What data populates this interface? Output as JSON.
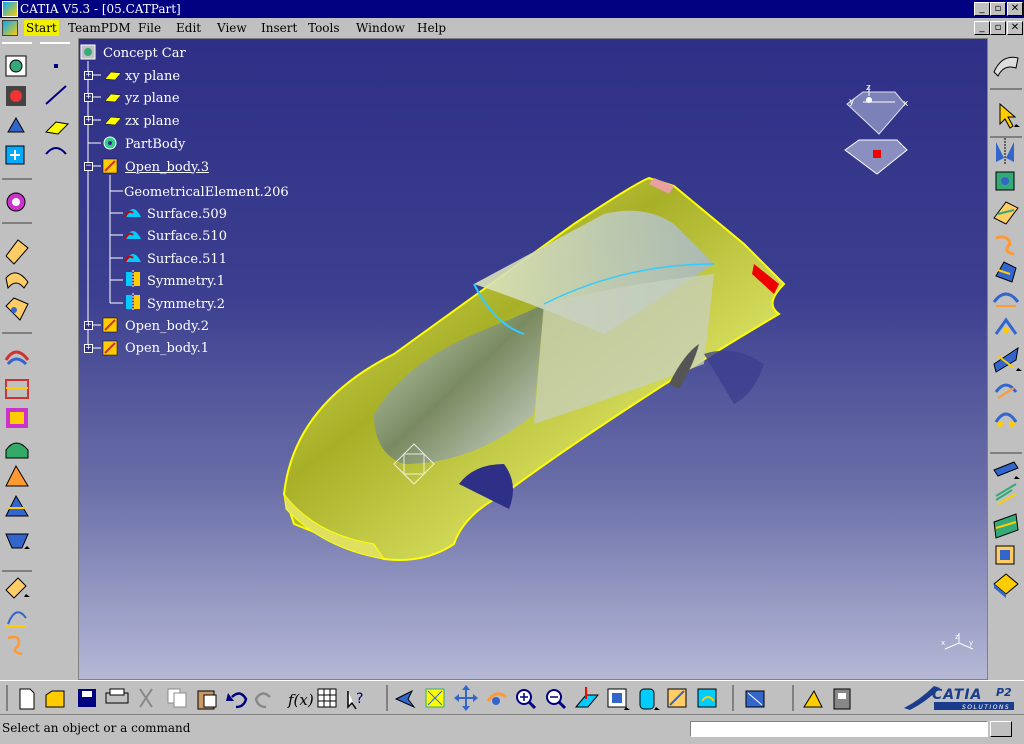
{
  "window": {
    "title": "CATIA V5.3 - [05.CATPart]"
  },
  "menu": {
    "items": [
      "Start",
      "TeamPDM",
      "File",
      "Edit",
      "View",
      "Insert",
      "Tools",
      "Window",
      "Help"
    ]
  },
  "tree": {
    "root": "Concept Car",
    "nodes": [
      {
        "label": "xy plane"
      },
      {
        "label": "yz plane"
      },
      {
        "label": "zx plane"
      },
      {
        "label": "PartBody"
      },
      {
        "label": "Open_body.3"
      },
      {
        "label": "GeometricalElement.206"
      },
      {
        "label": "Surface.509"
      },
      {
        "label": "Surface.510"
      },
      {
        "label": "Surface.511"
      },
      {
        "label": "Symmetry.1"
      },
      {
        "label": "Symmetry.2"
      },
      {
        "label": "Open_body.2"
      },
      {
        "label": "Open_body.1"
      }
    ]
  },
  "compass": {
    "x": "x",
    "y": "y",
    "z": "z"
  },
  "status": {
    "text": "Select an object or a command",
    "input": ""
  },
  "logo": {
    "brand": "CATIA",
    "version": "P2",
    "tagline": "SOLUTIONS"
  },
  "colors": {
    "viewport_top": "#2e2f86",
    "viewport_bottom": "#b6b8d6",
    "titlebar": "#000080",
    "menu_active": "#f0f000",
    "car_body": "#c8d040"
  }
}
